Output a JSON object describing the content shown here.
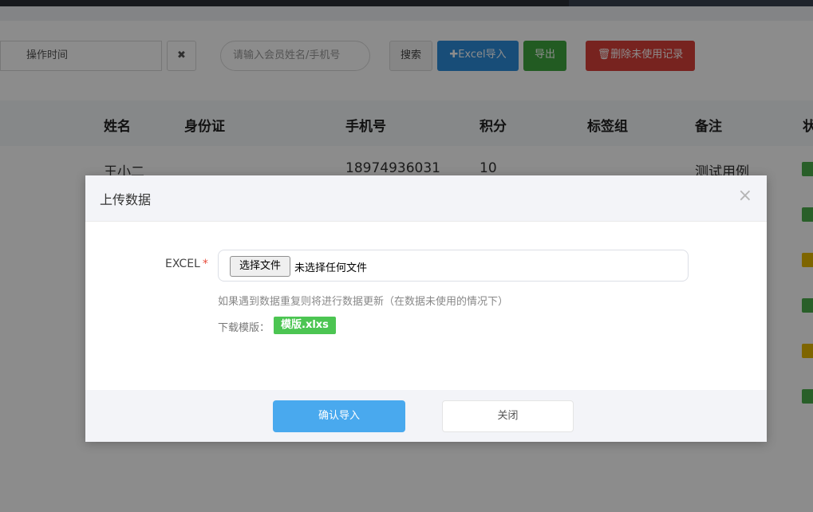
{
  "toolbar": {
    "date_filter_placeholder": "操作时间",
    "clear_symbol": "✖",
    "search_placeholder": "请输入会员姓名/手机号",
    "search_button": "搜索",
    "excel_import_button": "✚Excel导入",
    "export_button": "导出",
    "delete_unused_button": "🗑删除未使用记录",
    "colors": {
      "excel_import": "#2d8cdb",
      "export": "#3fa63f",
      "delete_unused": "#d9403a"
    }
  },
  "table": {
    "columns": [
      "姓名",
      "身份证",
      "手机号",
      "积分",
      "标签组",
      "备注",
      "状"
    ],
    "rows": [
      {
        "name": "王小二",
        "id_card": "",
        "phone": "18974936031",
        "points": "10",
        "tags": "",
        "remark": "测试用例",
        "status_color": "#4cae4c"
      },
      {
        "name": "",
        "id_card": "",
        "phone": "",
        "points": "",
        "tags": "",
        "remark": "",
        "status_color": "#4cae4c"
      },
      {
        "name": "",
        "id_card": "",
        "phone": "",
        "points": "",
        "tags": "",
        "remark": "",
        "status_color": "#e6b800"
      },
      {
        "name": "",
        "id_card": "",
        "phone": "",
        "points": "",
        "tags": "",
        "remark": "",
        "status_color": "#4cae4c"
      },
      {
        "name": "",
        "id_card": "",
        "phone": "",
        "points": "",
        "tags": "",
        "remark": "",
        "status_color": "#e6b800"
      },
      {
        "name": "",
        "id_card": "",
        "phone": "",
        "points": "",
        "tags": "",
        "remark": "",
        "status_color": "#4cae4c"
      }
    ]
  },
  "modal": {
    "title": "上传数据",
    "close_symbol": "×",
    "field_label": "EXCEL",
    "required_mark": "*",
    "file_button": "选择文件",
    "file_status": "未选择任何文件",
    "hint": "如果遇到数据重复则将进行数据更新（在数据未使用的情况下）",
    "download_label": "下载模版：",
    "download_link": "模版.xlxs",
    "confirm_button": "确认导入",
    "close_button": "关闭"
  }
}
